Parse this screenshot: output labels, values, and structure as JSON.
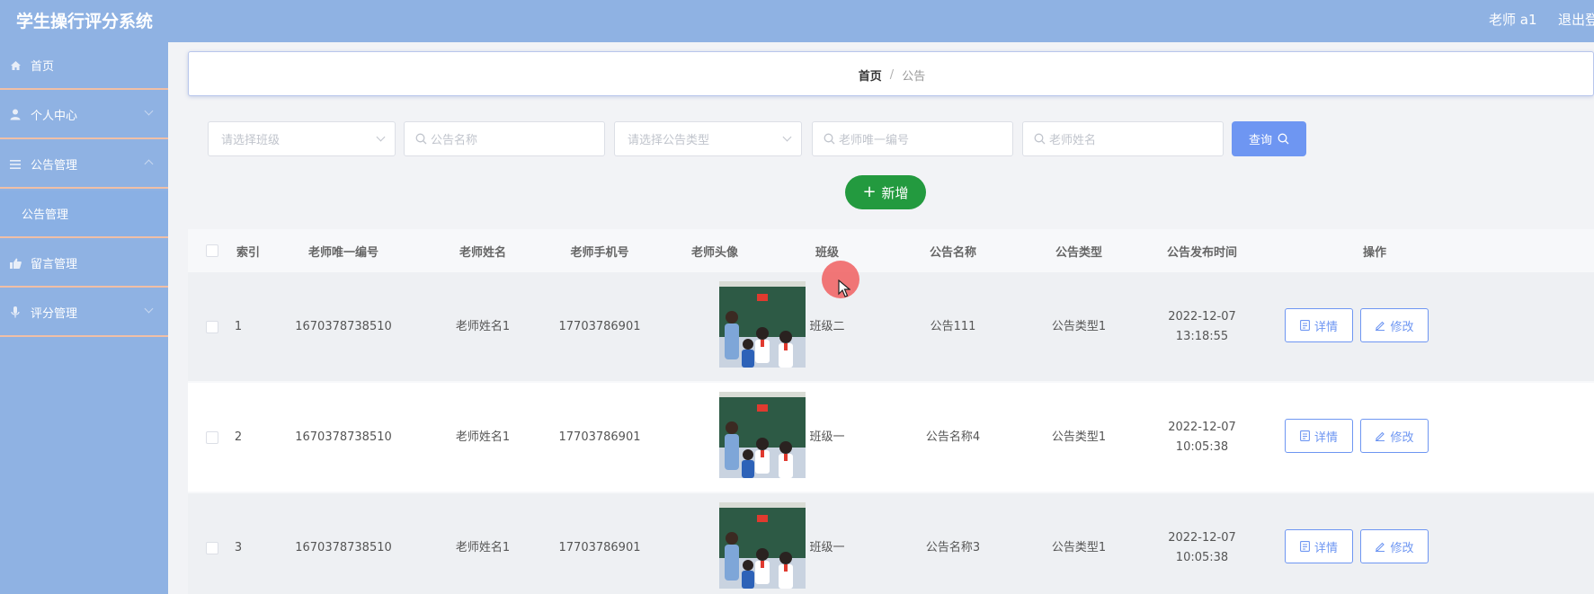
{
  "app": {
    "title": "学生操行评分系统",
    "user": "老师 a1",
    "logout": "退出登录"
  },
  "sidebar": {
    "items": [
      {
        "label": "首页",
        "icon": "home-icon"
      },
      {
        "label": "个人中心",
        "icon": "user-icon"
      },
      {
        "label": "公告管理",
        "icon": "menu-icon"
      },
      {
        "label": "公告管理",
        "sub": true
      },
      {
        "label": "留言管理",
        "icon": "thumb-icon"
      },
      {
        "label": "评分管理",
        "icon": "mic-icon"
      }
    ]
  },
  "breadcrumb": {
    "home": "首页",
    "separator": "/",
    "current": "公告"
  },
  "filters": {
    "class_placeholder": "请选择班级",
    "name_placeholder": "公告名称",
    "type_placeholder": "请选择公告类型",
    "teacher_id_placeholder": "老师唯一编号",
    "teacher_name_placeholder": "老师姓名",
    "query_label": "查询"
  },
  "add_button": "新增",
  "table": {
    "headers": [
      "索引",
      "老师唯一编号",
      "老师姓名",
      "老师手机号",
      "老师头像",
      "班级",
      "公告名称",
      "公告类型",
      "公告发布时间",
      "操作"
    ],
    "rows": [
      {
        "index": "1",
        "teacher_id": "1670378738510",
        "teacher_name": "老师姓名1",
        "phone": "17703786901",
        "class": "班级二",
        "title": "公告111",
        "type": "公告类型1",
        "time": "2022-12-07 13:18:55"
      },
      {
        "index": "2",
        "teacher_id": "1670378738510",
        "teacher_name": "老师姓名1",
        "phone": "17703786901",
        "class": "班级一",
        "title": "公告名称4",
        "type": "公告类型1",
        "time": "2022-12-07 10:05:38"
      },
      {
        "index": "3",
        "teacher_id": "1670378738510",
        "teacher_name": "老师姓名1",
        "phone": "17703786901",
        "class": "班级一",
        "title": "公告名称3",
        "type": "公告类型1",
        "time": "2022-12-07 10:05:38"
      }
    ],
    "detail_label": "详情",
    "edit_label": "修改"
  },
  "colors": {
    "header_bg": "#8fb2e3",
    "primary": "#6e96f2",
    "add_green": "#239a3f",
    "divider": "#f0bfa6"
  }
}
